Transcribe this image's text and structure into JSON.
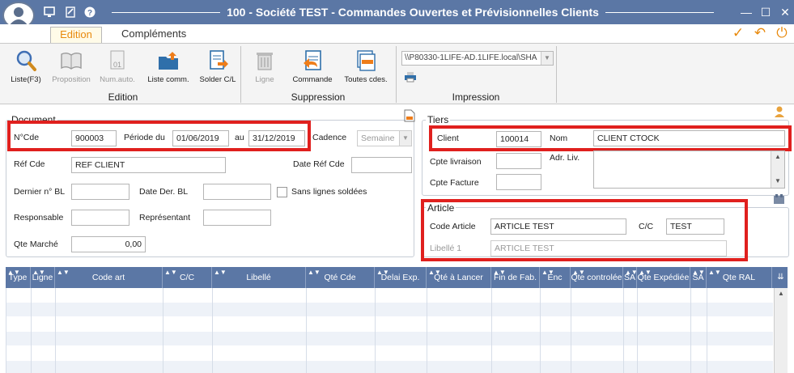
{
  "window": {
    "title": "100 - Société TEST -  Commandes Ouvertes et Prévisionnelles Clients",
    "controls": [
      "—",
      "☐",
      "✕"
    ]
  },
  "tabs": [
    "Edition",
    "Compléments"
  ],
  "ribbon": {
    "edition": {
      "label": "Edition",
      "buttons": [
        "Liste(F3)",
        "Proposition",
        "Num.auto.",
        "Liste comm.",
        "Solder C/L"
      ]
    },
    "suppression": {
      "label": "Suppression",
      "buttons": [
        "Ligne",
        "Commande",
        "Toutes cdes."
      ]
    },
    "impression": {
      "label": "Impression",
      "printer_path": "\\\\P80330-1LIFE-AD.1LIFE.local\\SHA"
    }
  },
  "document": {
    "legend": "Document",
    "ncde_label": "N°Cde",
    "ncde": "900003",
    "periode_label": "Période du",
    "periode_du": "01/06/2019",
    "au_label": "au",
    "periode_au": "31/12/2019",
    "cadence_label": "Cadence",
    "cadence": "Semaine",
    "ref_cde_label": "Réf Cde",
    "ref_cde": "REF CLIENT",
    "date_ref_cde_label": "Date Réf Cde",
    "date_ref_cde": "",
    "dernier_bl_label": "Dernier n° BL",
    "dernier_bl": "",
    "date_der_bl_label": "Date Der. BL",
    "date_der_bl": "",
    "sans_lignes_label": "Sans lignes soldées",
    "responsable_label": "Responsable",
    "responsable": "",
    "representant_label": "Représentant",
    "representant": "",
    "qte_marche_label": "Qte Marché",
    "qte_marche": "0,00"
  },
  "tiers": {
    "legend": "Tiers",
    "client_label": "Client",
    "client": "100014",
    "nom_label": "Nom",
    "nom": "CLIENT CTOCK",
    "cpte_livraison_label": "Cpte livraison",
    "cpte_livraison": "",
    "adr_liv_label": "Adr. Liv.",
    "cpte_facture_label": "Cpte Facture",
    "cpte_facture": ""
  },
  "article": {
    "legend": "Article",
    "code_label": "Code Article",
    "code": "ARTICLE TEST",
    "cc_label": "C/C",
    "cc": "TEST",
    "libelle_label": "Libellé 1",
    "libelle": "ARTICLE TEST"
  },
  "grid": {
    "columns": [
      "Type",
      "Ligne",
      "Code art",
      "C/C",
      "Libellé",
      "Qté Cde",
      "Delai Exp.",
      "Qté à Lancer",
      "Fin de Fab.",
      "Enc",
      "Qte controlée",
      "SA",
      "Qte Expédiée",
      "SA",
      "Qte RAL"
    ]
  },
  "colors": {
    "titlebar": "#5b77a5",
    "highlight": "#e0201e",
    "accent": "#e8890c"
  }
}
